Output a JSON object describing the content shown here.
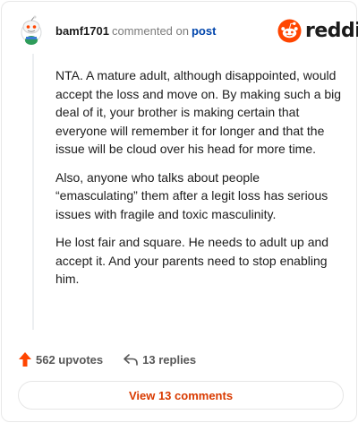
{
  "header": {
    "username": "bamf1701",
    "verb": "commented on",
    "link": "post",
    "brand": "reddit",
    "avatar_icon": "snoo-avatar-icon",
    "brand_icon": "reddit-logo-icon"
  },
  "comment": {
    "paragraphs": [
      "NTA. A mature adult, although disappointed, would accept the loss and move on. By making such a big deal of it, your brother is making certain that everyone will remember it for longer and that the issue will be cloud over his head for more time.",
      "Also, anyone who talks about people “emasculating” them after a legit loss has serious issues with fragile and toxic masculinity.",
      "He lost fair and square. He needs to adult up and accept it. And your parents need to stop enabling him."
    ]
  },
  "actions": {
    "upvotes": "562 upvotes",
    "upvote_icon": "upvote-arrow-icon",
    "replies": "13 replies",
    "reply_icon": "reply-arrow-icon"
  },
  "footer": {
    "view_label": "View 13 comments"
  },
  "colors": {
    "brand_orange": "#ff4500",
    "link_blue": "#0045ac",
    "view_text": "#d93a00",
    "muted": "#7c7c7c"
  }
}
